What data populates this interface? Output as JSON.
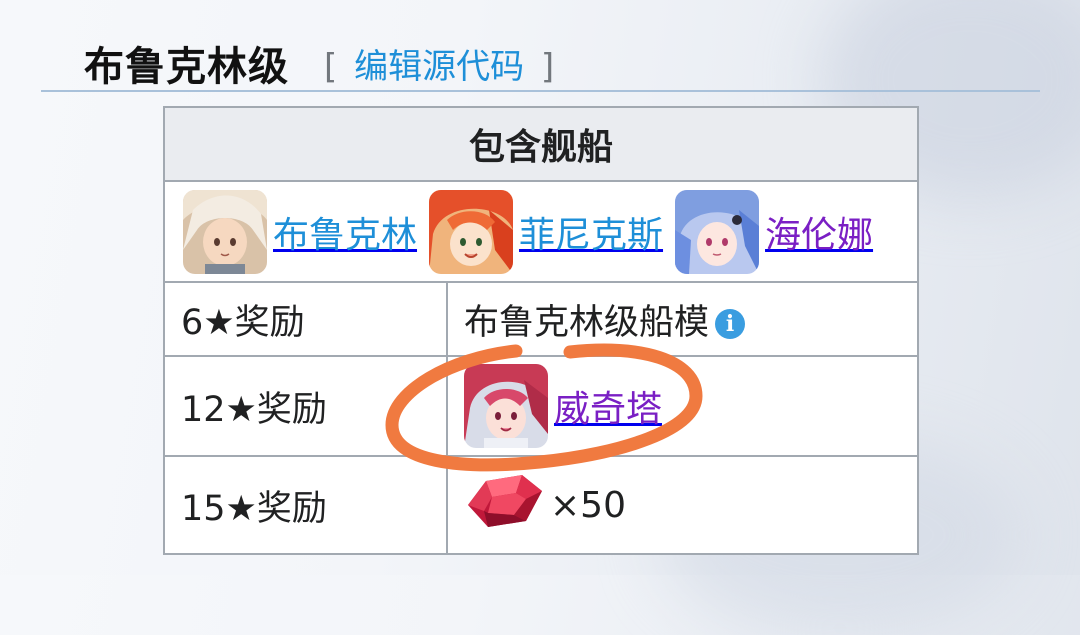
{
  "section": {
    "title": "布鲁克林级",
    "edit_bracket_open": "[",
    "edit_link": "编辑源代码",
    "edit_bracket_close": "]"
  },
  "table": {
    "header": "包含舰船",
    "ships": [
      {
        "name": "布鲁克林",
        "color": "#1e8fd8",
        "icon": "brooklyn-avatar"
      },
      {
        "name": "菲尼克斯",
        "color": "#1e8fd8",
        "icon": "phoenix-avatar"
      },
      {
        "name": "海伦娜",
        "color": "#7a1fc4",
        "icon": "helena-avatar"
      }
    ],
    "rewards": [
      {
        "label": "6★奖励",
        "value": "布鲁克林级船模",
        "icon": "info-icon"
      },
      {
        "label": "12★奖励",
        "value": "威奇塔",
        "color": "#7a1fc4",
        "icon": "wichita-avatar"
      },
      {
        "label": "15★奖励",
        "value": "×50",
        "icon": "gem-icon"
      }
    ]
  },
  "info_icon_glyph": "i",
  "annotation_color": "#f07a40"
}
